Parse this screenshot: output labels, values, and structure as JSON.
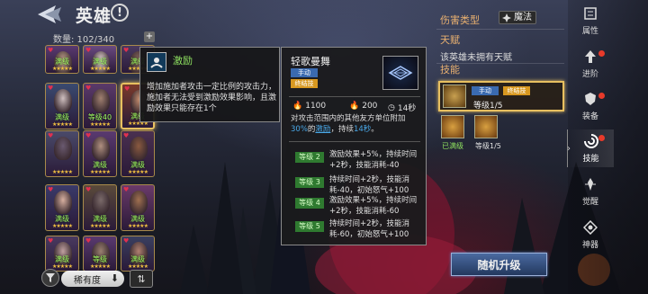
{
  "header": {
    "title": "英雄",
    "info_glyph": "!"
  },
  "hero_list": {
    "count_label": "数量: 102/340",
    "plus_glyph": "+",
    "cards": [
      {
        "tag": "满级",
        "stars": "★★★★★"
      },
      {
        "tag": "满级",
        "stars": "★★★★★"
      },
      {
        "tag": "满级",
        "stars": "★★★★★"
      },
      {
        "tag": "满级",
        "stars": "★★★★★"
      },
      {
        "tag": "等级40",
        "stars": "★★★★★"
      },
      {
        "tag": "满级",
        "stars": "★★★★★"
      },
      {
        "tag": "",
        "stars": "★★★★★"
      },
      {
        "tag": "满级",
        "stars": "★★★★★"
      },
      {
        "tag": "满级",
        "stars": "★★★★★"
      },
      {
        "tag": "满级",
        "stars": "★★★★★"
      },
      {
        "tag": "满级",
        "stars": "★★★★★"
      },
      {
        "tag": "满级",
        "stars": "★★★★★"
      },
      {
        "tag": "满级",
        "stars": "★★★★★"
      },
      {
        "tag": "等级",
        "stars": "★★★★★"
      },
      {
        "tag": "满级",
        "stars": "★★★★★"
      }
    ],
    "sort_label": "稀有度",
    "sort_arrow": "⬇",
    "sort_order_glyph": "⇅"
  },
  "tooltip": {
    "title": "激励",
    "desc": "增加施加者攻击一定比例的攻击力，施加者无法受到激励效果影响，且激励效果只能存在1个"
  },
  "skill_detail": {
    "name": "轻歌曼舞",
    "badge_manual": "手动",
    "badge_ult": "终结技",
    "stat_a": "1100",
    "stat_b": "200",
    "stat_c": "14秒",
    "desc_1": "对攻击范围内的其他友方单位附加",
    "desc_pct": "30%",
    "desc_2": "的",
    "desc_link": "激励",
    "desc_3": "，持续",
    "desc_dur": "14秒",
    "desc_4": "。",
    "levels": [
      {
        "badge": "等级 2",
        "text": "激励效果+5%，持续时间+2秒，技能消耗-40"
      },
      {
        "badge": "等级 3",
        "text": "持续时间+2秒，技能消耗-40，初始怒气+100"
      },
      {
        "badge": "等级 4",
        "text": "激励效果+5%，持续时间+2秒，技能消耗-60"
      },
      {
        "badge": "等级 5",
        "text": "持续时间+2秒，技能消耗-60，初始怒气+100"
      }
    ]
  },
  "right_panel": {
    "damage_type_label": "伤害类型",
    "damage_type_value": "魔法",
    "talent_label": "天赋",
    "talent_text": "该英雄未拥有天赋",
    "skills_label": "技能",
    "slot_badge_manual": "手动",
    "slot_badge_ult": "终结技",
    "slot_level": "等级1/5",
    "mini_a_label": "已满级",
    "mini_b_label": "等级1/5",
    "upgrade_button": "随机升级"
  },
  "nav": {
    "items": [
      {
        "label": "属性"
      },
      {
        "label": "进阶"
      },
      {
        "label": "装备"
      },
      {
        "label": "技能"
      },
      {
        "label": "觉醒"
      },
      {
        "label": "神器"
      }
    ],
    "collapse_glyph": "›"
  },
  "colors": {
    "gold_border": "#e8c060",
    "level_green": "#2f7a30",
    "manual_blue": "#3a6ab0",
    "ult_orange": "#d89820",
    "highlight_blue": "#4aa8e8",
    "section_orange": "#e8b070"
  }
}
